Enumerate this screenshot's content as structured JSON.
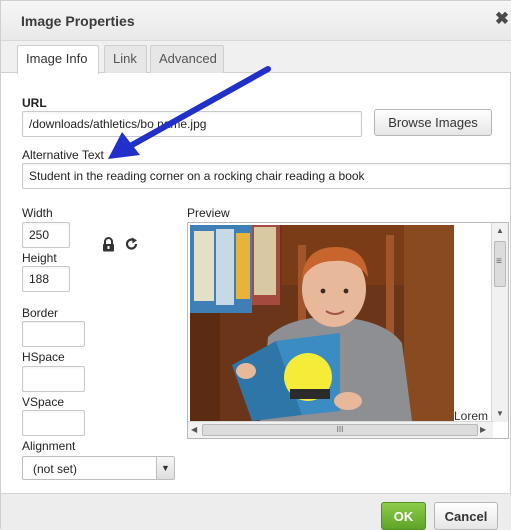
{
  "dialog": {
    "title": "Image Properties",
    "close_glyph": "✖"
  },
  "tabs": [
    {
      "label": "Image Info",
      "active": true
    },
    {
      "label": "Link",
      "active": false
    },
    {
      "label": "Advanced",
      "active": false
    }
  ],
  "url": {
    "label": "URL",
    "value": "/downloads/athletics/bo name.jpg"
  },
  "browse_button": "Browse Images",
  "alt_text": {
    "label": "Alternative Text",
    "value": "Student in the reading corner on a rocking chair reading a book"
  },
  "width": {
    "label": "Width",
    "value": "250"
  },
  "height": {
    "label": "Height",
    "value": "188"
  },
  "lock_icon": "lock-icon",
  "reset_icon": "reset-size-icon",
  "border": {
    "label": "Border",
    "value": ""
  },
  "hspace": {
    "label": "HSpace",
    "value": ""
  },
  "vspace": {
    "label": "VSpace",
    "value": ""
  },
  "alignment": {
    "label": "Alignment",
    "value": "(not set)"
  },
  "preview": {
    "label": "Preview",
    "lorem_text": "Lorem",
    "hscroll_grip": "III",
    "vscroll_grip": "≡"
  },
  "footer": {
    "ok_label": "OK",
    "cancel_label": "Cancel"
  },
  "colors": {
    "ok_button": "#73b932",
    "annotation_arrow": "#2130c9"
  }
}
